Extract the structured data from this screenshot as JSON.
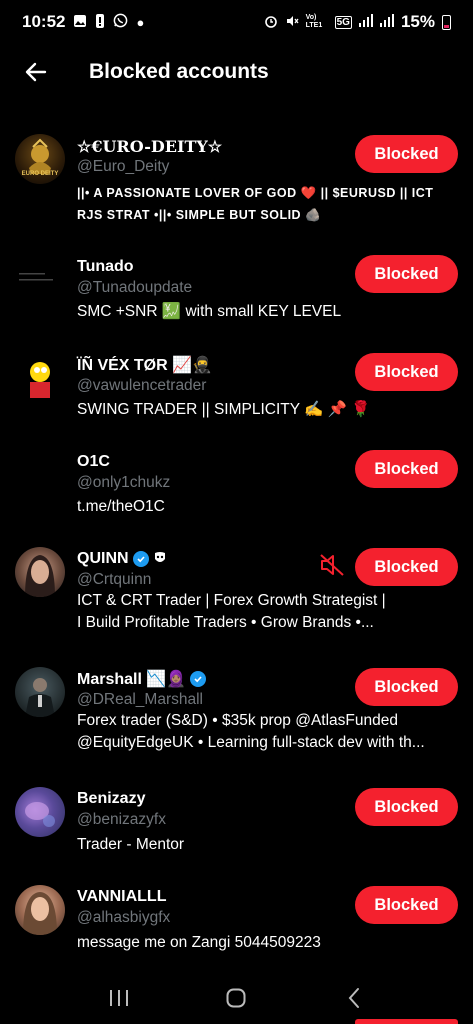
{
  "status_bar": {
    "time": "10:52",
    "network": "5G",
    "volte": "Vo) LTE1",
    "battery_pct": "15%"
  },
  "header": {
    "title": "Blocked accounts"
  },
  "accounts": [
    {
      "name": "☆€URO-DEITY☆",
      "handle": "@Euro_Deity",
      "bio": "||• A PASSIONATE LOVER OF GOD ❤️ || $EURUSD || ICT RJS STRAT •||• SIMPLE BUT SOLID 🪨",
      "button": "Blocked",
      "avatar_caption": "EURO DEITY"
    },
    {
      "name": "Tunado",
      "handle": "@Tunadoupdate",
      "bio": "SMC +SNR 💹 with small KEY LEVEL",
      "button": "Blocked"
    },
    {
      "name": "ÏÑ VÉX TØR 📈🥷",
      "handle": "@vawulencetrader",
      "bio": "SWING TRADER  || SIMPLICITY ✍️ 📌 🌹",
      "button": "Blocked"
    },
    {
      "name": "O1C",
      "handle": "@only1chukz",
      "bio": "t.me/theO1C",
      "button": "Blocked"
    },
    {
      "name": "QUINN",
      "handle": "@Crtquinn",
      "bio_line1": "ICT & CRT Trader | Forex Growth Strategist |",
      "bio_line2": "I Build Profitable Traders • Grow Brands •...",
      "button": "Blocked",
      "muted": true
    },
    {
      "name": "Marshall 📉🧕🏽",
      "handle": "@DReal_Marshall",
      "bio_line1": "Forex trader (S&D) • $35k prop @AtlasFunded",
      "bio_line2": "@EquityEdgeUK • Learning full-stack dev with th...",
      "button": "Blocked"
    },
    {
      "name": "Benizazy",
      "handle": "@benizazyfx",
      "bio": "Trader - Mentor",
      "button": "Blocked"
    },
    {
      "name": "VANNIALLL",
      "handle": "@alhasbiygfx",
      "bio": "message me on Zangi 5044509223",
      "button": "Blocked"
    }
  ],
  "colors": {
    "background": "#000000",
    "blocked_button": "#f4212e",
    "handle_text": "#71767b",
    "verified": "#1d9bf0"
  }
}
